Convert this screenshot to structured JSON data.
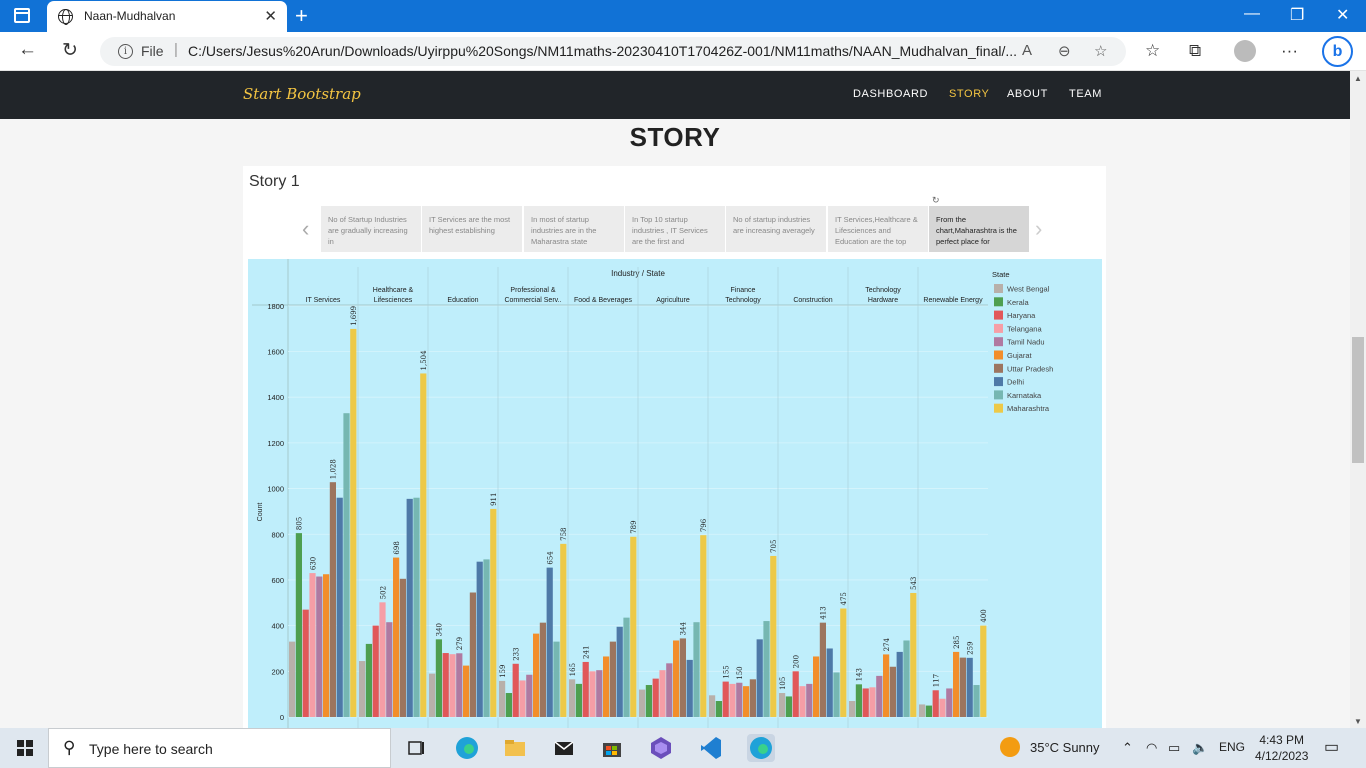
{
  "browser": {
    "tab_title": "Naan-Mudhalvan",
    "url_prefix": "File",
    "url": "C:/Users/Jesus%20Arun/Downloads/Uyirppu%20Songs/NM11maths-20230410T170426Z-001/NM11maths/NAAN_Mudhalvan_final/..."
  },
  "site": {
    "brand": "Start Bootstrap",
    "nav": [
      "DASHBOARD",
      "STORY",
      "ABOUT",
      "TEAM"
    ],
    "active_nav": "STORY",
    "heading": "STORY"
  },
  "story": {
    "title": "Story 1",
    "captions": [
      "No of Startup Industries are gradually increasing in",
      "IT Services are the most highest establishing",
      "In most of startup industries are in the Maharastra state",
      "In Top 10 startup industries , IT Services are the first and",
      "No of startup industries are increasing averagely",
      "IT Services,Healthcare & Lifesciences and Education are the top",
      "From the chart,Maharashtra is the perfect place for"
    ],
    "active_caption": 6
  },
  "chart_data": {
    "type": "bar",
    "title": "Industry / State",
    "ylabel": "Count",
    "ylim": [
      0,
      1900
    ],
    "yticks": [
      0,
      200,
      400,
      600,
      800,
      1000,
      1200,
      1400,
      1600,
      1800
    ],
    "legend_title": "State",
    "legend_position": "right",
    "categories": [
      "IT Services",
      "Healthcare & Lifesciences",
      "Education",
      "Professional & Commercial Serv..",
      "Food & Beverages",
      "Agriculture",
      "Finance Technology",
      "Construction",
      "Technology Hardware",
      "Renewable Energy"
    ],
    "series": [
      {
        "name": "West Bengal",
        "color": "#b8b0aa",
        "values": [
          330,
          245,
          190,
          158,
          165,
          120,
          95,
          105,
          70,
          55
        ]
      },
      {
        "name": "Kerala",
        "color": "#4e9f50",
        "values": [
          805,
          320,
          340,
          105,
          145,
          140,
          70,
          90,
          143,
          50
        ]
      },
      {
        "name": "Haryana",
        "color": "#e15759",
        "values": [
          470,
          400,
          280,
          233,
          241,
          168,
          155,
          200,
          125,
          117
        ]
      },
      {
        "name": "Telangana",
        "color": "#f69ea6",
        "values": [
          630,
          502,
          275,
          160,
          200,
          205,
          145,
          135,
          130,
          80
        ]
      },
      {
        "name": "Tamil Nadu",
        "color": "#b07aa1",
        "values": [
          615,
          415,
          279,
          185,
          205,
          235,
          150,
          145,
          180,
          125
        ]
      },
      {
        "name": "Gujarat",
        "color": "#f28e2b",
        "values": [
          625,
          698,
          225,
          365,
          265,
          335,
          135,
          265,
          274,
          285
        ]
      },
      {
        "name": "Uttar Pradesh",
        "color": "#9c755f",
        "values": [
          1028,
          605,
          545,
          413,
          330,
          344,
          165,
          413,
          220,
          260
        ]
      },
      {
        "name": "Delhi",
        "color": "#4e79a7",
        "values": [
          960,
          955,
          680,
          654,
          395,
          250,
          340,
          300,
          285,
          259
        ]
      },
      {
        "name": "Karnataka",
        "color": "#76b7b2",
        "values": [
          1330,
          960,
          690,
          330,
          435,
          415,
          420,
          195,
          335,
          140
        ]
      },
      {
        "name": "Maharashtra",
        "color": "#edc948",
        "values": [
          1699,
          1504,
          911,
          758,
          789,
          796,
          705,
          475,
          543,
          400
        ]
      }
    ],
    "data_labels": [
      {
        "category": 0,
        "series": "Kerala",
        "value": "805"
      },
      {
        "category": 0,
        "series": "Telangana",
        "value": "630"
      },
      {
        "category": 0,
        "series": "Uttar Pradesh",
        "value": "1,028"
      },
      {
        "category": 0,
        "series": "Maharashtra",
        "value": "1,699"
      },
      {
        "category": 1,
        "series": "Telangana",
        "value": "502"
      },
      {
        "category": 1,
        "series": "Gujarat",
        "value": "698"
      },
      {
        "category": 1,
        "series": "Maharashtra",
        "value": "1,504"
      },
      {
        "category": 2,
        "series": "Kerala",
        "value": "340"
      },
      {
        "category": 2,
        "series": "Tamil Nadu",
        "value": "279"
      },
      {
        "category": 2,
        "series": "Maharashtra",
        "value": "911"
      },
      {
        "category": 3,
        "series": "West Bengal",
        "value": "159"
      },
      {
        "category": 3,
        "series": "Haryana",
        "value": "233"
      },
      {
        "category": 3,
        "series": "Delhi",
        "value": "654"
      },
      {
        "category": 3,
        "series": "Maharashtra",
        "value": "758"
      },
      {
        "category": 4,
        "series": "West Bengal",
        "value": "165"
      },
      {
        "category": 4,
        "series": "Haryana",
        "value": "241"
      },
      {
        "category": 4,
        "series": "Maharashtra",
        "value": "789"
      },
      {
        "category": 5,
        "series": "Uttar Pradesh",
        "value": "344"
      },
      {
        "category": 5,
        "series": "Maharashtra",
        "value": "796"
      },
      {
        "category": 6,
        "series": "Haryana",
        "value": "155"
      },
      {
        "category": 6,
        "series": "Tamil Nadu",
        "value": "150"
      },
      {
        "category": 6,
        "series": "Maharashtra",
        "value": "705"
      },
      {
        "category": 7,
        "series": "West Bengal",
        "value": "105"
      },
      {
        "category": 7,
        "series": "Haryana",
        "value": "200"
      },
      {
        "category": 7,
        "series": "Uttar Pradesh",
        "value": "413"
      },
      {
        "category": 7,
        "series": "Maharashtra",
        "value": "475"
      },
      {
        "category": 8,
        "series": "Kerala",
        "value": "143"
      },
      {
        "category": 8,
        "series": "Gujarat",
        "value": "274"
      },
      {
        "category": 8,
        "series": "Maharashtra",
        "value": "543"
      },
      {
        "category": 9,
        "series": "Haryana",
        "value": "117"
      },
      {
        "category": 9,
        "series": "Gujarat",
        "value": "285"
      },
      {
        "category": 9,
        "series": "Delhi",
        "value": "259"
      },
      {
        "category": 9,
        "series": "Maharashtra",
        "value": "400"
      }
    ]
  },
  "taskbar": {
    "search_placeholder": "Type here to search",
    "weather": "35°C  Sunny",
    "lang": "ENG",
    "time": "4:43 PM",
    "date": "4/12/2023"
  }
}
